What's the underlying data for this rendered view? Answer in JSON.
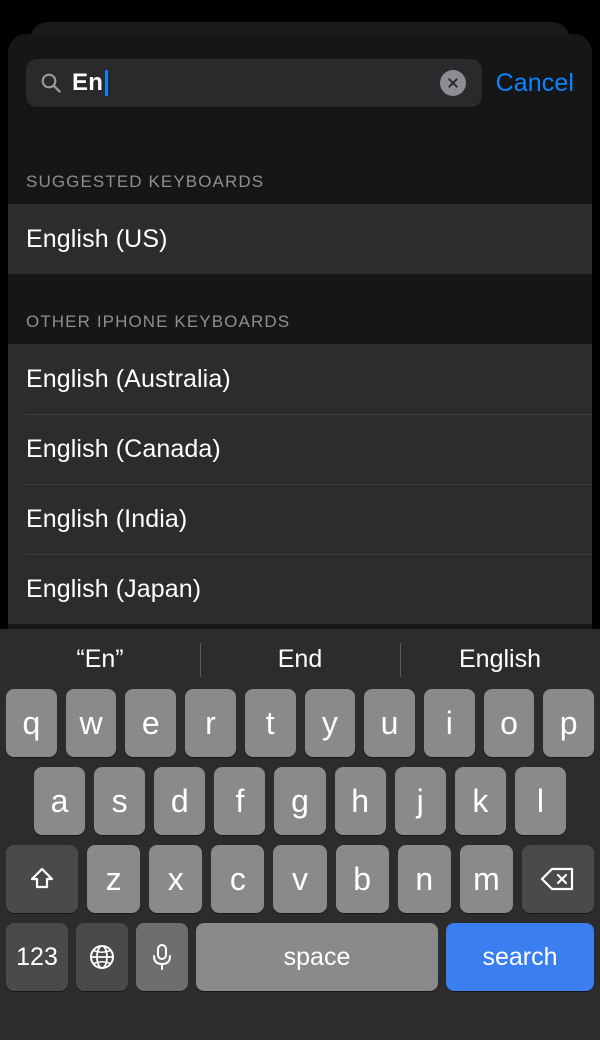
{
  "search": {
    "value": "En",
    "placeholder": "Search",
    "icon": "search-icon",
    "clear_icon": "clear-circle-icon",
    "cancel_label": "Cancel",
    "accent_color": "#0a84ff"
  },
  "sections": [
    {
      "header": "SUGGESTED KEYBOARDS",
      "items": [
        {
          "label": "English (US)"
        }
      ]
    },
    {
      "header": "OTHER IPHONE KEYBOARDS",
      "items": [
        {
          "label": "English (Australia)"
        },
        {
          "label": "English (Canada)"
        },
        {
          "label": "English (India)"
        },
        {
          "label": "English (Japan)"
        }
      ]
    }
  ],
  "keyboard": {
    "suggestions": [
      "“En”",
      "End",
      "English"
    ],
    "row1": [
      "q",
      "w",
      "e",
      "r",
      "t",
      "y",
      "u",
      "i",
      "o",
      "p"
    ],
    "row2": [
      "a",
      "s",
      "d",
      "f",
      "g",
      "h",
      "j",
      "k",
      "l"
    ],
    "row3": [
      "z",
      "x",
      "c",
      "v",
      "b",
      "n",
      "m"
    ],
    "shift_icon": "shift-arrow-icon",
    "backspace_icon": "backspace-icon",
    "numbers_label": "123",
    "globe_icon": "globe-icon",
    "mic_icon": "microphone-icon",
    "space_label": "space",
    "return_label": "search",
    "return_color": "#3b7ef0"
  }
}
